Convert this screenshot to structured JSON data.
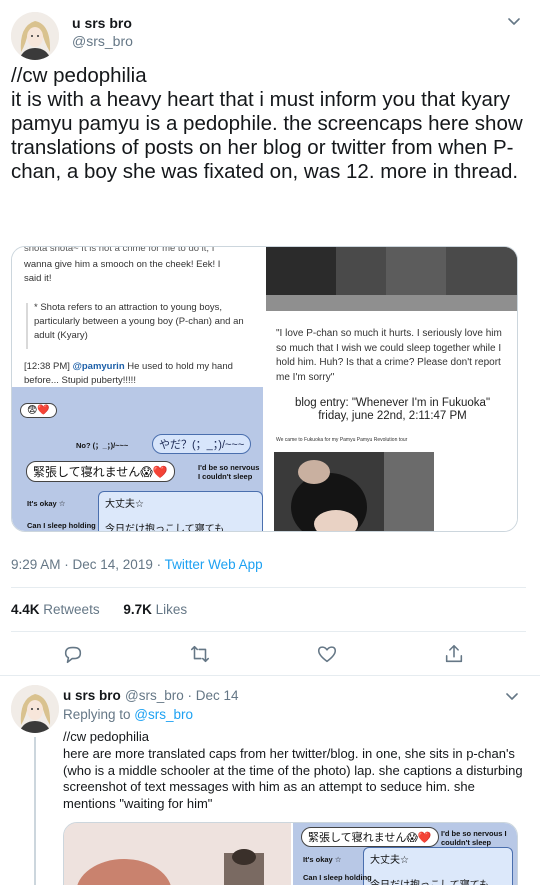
{
  "main_tweet": {
    "author_name": "u srs bro",
    "author_handle": "@srs_bro",
    "text": "//cw pedophilia\nit is with a heavy heart that i must inform you that kyary pamyu pamyu is a pedophile. the screencaps here show translations of posts on her blog or twitter from when P-chan, a boy she was fixated on, was 12. more in thread.",
    "timestamp": "9:29 AM · Dec 14, 2019 · ",
    "source": "Twitter Web App",
    "retweets_count": "4.4K",
    "retweets_label": "Retweets",
    "likes_count": "9.7K",
    "likes_label": "Likes"
  },
  "left_image": {
    "top_line": "shota shota~ It is not a crime for me to do it, I",
    "line2": "wanna give him a smooch on the cheek! Eek! I",
    "line3": "said it!",
    "note": "* Shota refers to an attraction to young boys, particularly between a young boy (P-chan) and an adult (Kyary)",
    "time": "[12:38 PM] ",
    "handle": "@pamyurin",
    "reply": " He used to hold my hand before... Stupid puberty!!!!!",
    "chat_emoji_bubble": "😨❤️",
    "chat_no": "No? (；_；)/~~~",
    "chat_yada": "やだ？(；_；)/~~~",
    "chat_nervous_jp": "緊張して寝れません😱❤️",
    "chat_nervous_en": "I'd be so nervous I couldn't sleep",
    "chat_okay_en": "It's okay ☆",
    "chat_okay_jp": "大丈夫☆",
    "chat_hold_en": "Can I sleep holding",
    "chat_hold_jp": "今日だけ抱っこして寝ても"
  },
  "right_image": {
    "quote": "\"I love P-chan so much it hurts. I seriously love him so much that I wish we could sleep together while I hold him. Huh? Is that a crime? Please don't report me I'm sorry\"",
    "blog_title": "blog entry: \"Whenever I'm in Fukuoka\"",
    "blog_date": "friday, june 22nd, 2:11:47 PM",
    "caption": "We came to Fukuoka for my Pamyu Pamyu Revolution tour"
  },
  "reply_tweet": {
    "author_name": "u srs bro",
    "meta": "@srs_bro · Dec 14",
    "replying_prefix": "Replying to ",
    "replying_handle": "@srs_bro",
    "text": "//cw pedophilia\nhere are more translated caps from her twitter/blog. in one, she sits in p-chan's (who is a middle schooler at the time of the photo) lap. she captions a disturbing screenshot of text messages with him as an attempt to seduce him. she mentions \"waiting for him\"",
    "chat_nervous_jp": "緊張して寝れません😱❤️",
    "chat_nervous_en": "I'd be so nervous I couldn't sleep",
    "chat_okay_en": "It's okay ☆",
    "chat_okay_jp": "大丈夫☆",
    "chat_hold_en": "Can I sleep holding",
    "chat_hold_jp": "今日だけ抱っこして寝ても"
  },
  "icons": {
    "reply": "reply-icon",
    "retweet": "retweet-icon",
    "like": "heart-icon",
    "share": "share-icon",
    "more": "chevron-down-icon"
  },
  "colors": {
    "accent": "#1da1f2",
    "secondary_text": "#657786",
    "border": "#e6ecf0"
  }
}
